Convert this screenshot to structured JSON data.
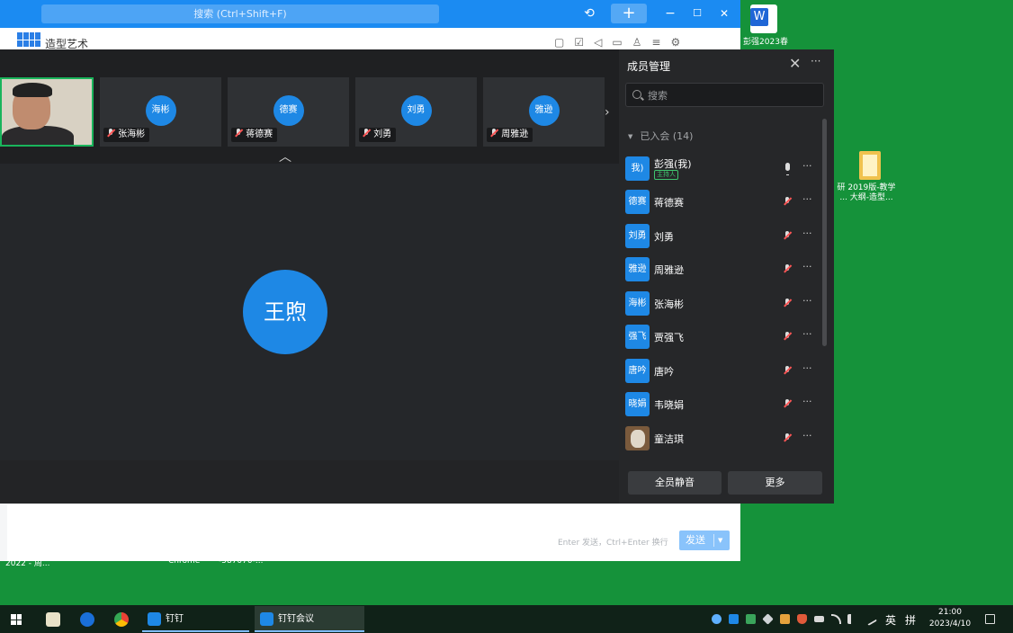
{
  "dingtalk": {
    "search_placeholder": "搜索 (Ctrl+Shift+F)",
    "history_icon": "⟲",
    "plus_label": "+",
    "minimize_label": "−",
    "maximize_label": "☐",
    "close_label": "✕",
    "group_title": "造型艺术",
    "subtoolbar_icons": "▢☑◁▭♙≡⚙",
    "send_hint": "Enter 发送，Ctrl+Enter 换行",
    "send_label": "发送",
    "send_arrow": "▼",
    "under_texts": [
      "2022 - 周...",
      "Chrome",
      "-587070-..."
    ]
  },
  "meeting": {
    "strip": [
      {
        "avatar": "海彬",
        "name": "张海彬"
      },
      {
        "avatar": "德赛",
        "name": "蒋德赛"
      },
      {
        "avatar": "刘勇",
        "name": "刘勇"
      },
      {
        "avatar": "雅逊",
        "name": "周雅逊"
      }
    ],
    "strip_next": "›",
    "strip_collapse": "︿",
    "main_speaker": "王煦"
  },
  "members_panel": {
    "title": "成员管理",
    "close": "✕",
    "more": "···",
    "search_placeholder": "搜索",
    "group_label": "已入会 (14)",
    "group_caret": "▼",
    "members": [
      {
        "avatar": "我)",
        "name": "彭强(我)",
        "role": "主持人",
        "mic": "on"
      },
      {
        "avatar": "德赛",
        "name": "蒋德赛",
        "mic": "off"
      },
      {
        "avatar": "刘勇",
        "name": "刘勇",
        "mic": "off"
      },
      {
        "avatar": "雅逊",
        "name": "周雅逊",
        "mic": "off"
      },
      {
        "avatar": "海彬",
        "name": "张海彬",
        "mic": "off"
      },
      {
        "avatar": "强飞",
        "name": "贾强飞",
        "mic": "off"
      },
      {
        "avatar": "唐吟",
        "name": "唐吟",
        "mic": "off"
      },
      {
        "avatar": "晓娟",
        "name": "韦晓娟",
        "mic": "off"
      },
      {
        "avatar": "",
        "name": "童洁琪",
        "mic": "off",
        "photo": true
      }
    ],
    "row_more": "···",
    "mute_all_label": "全员静音",
    "more_label": "更多"
  },
  "desktop": {
    "word_file_label": "彭强2023春",
    "word_glyph": "W",
    "folder_label_line1": "研 2019版-教学",
    "folder_label_line2": "... 大纲-造型..."
  },
  "taskbar": {
    "apps": [
      {
        "label": "钉钉"
      },
      {
        "label": "钉钉会议"
      }
    ],
    "ime_lang": "英",
    "ime_mode": "拼",
    "time": "21:00",
    "date": "2023/4/10"
  }
}
